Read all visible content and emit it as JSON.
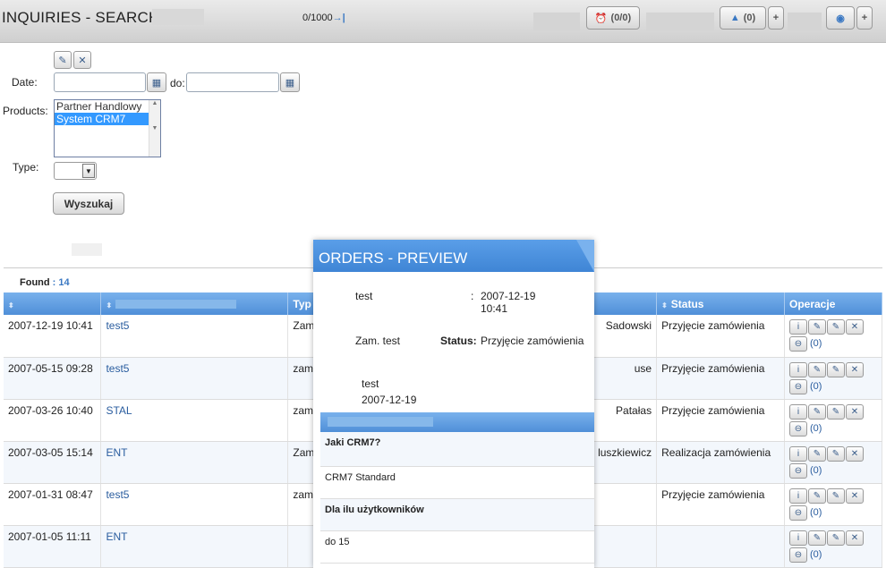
{
  "topbar": {
    "title": "INQUIRIES - SEARCH",
    "counter": "0/1000",
    "counter_arrow": "→|",
    "alarm_btn": "(0/0)",
    "bell_btn": "(0)",
    "plus": "+",
    "alarm_icon": "⏰",
    "bell_icon": "▲",
    "globe_icon": "◉"
  },
  "form": {
    "edit_icon": "✎",
    "close_icon": "✕",
    "date_label": "Date:",
    "do_label": "do:",
    "calendar_icon": "▦",
    "products_label": "Products:",
    "products": [
      {
        "label": "Partner Handlowy",
        "selected": false
      },
      {
        "label": "System CRM7",
        "selected": true
      }
    ],
    "type_label": "Type:",
    "dropdown_icon": "▼",
    "search_button": "Wyszukaj"
  },
  "results": {
    "found_label": "Found",
    "found_sep": ":",
    "found_count": "14",
    "columns": [
      "",
      "",
      "Typ",
      "",
      "Status",
      "Operacje"
    ],
    "sort_icon": "⬍",
    "op_icons": [
      "i",
      "✎",
      "✎",
      "✕"
    ],
    "link_icon": "⊖",
    "rows": [
      {
        "date": "2007-12-19 10:41",
        "name": "test5",
        "typ": "Zam.",
        "person": "Sadowski",
        "status": "Przyjęcie zamówienia",
        "count": "(0)"
      },
      {
        "date": "2007-05-15 09:28",
        "name": "test5",
        "typ": "zamo",
        "person": "use",
        "status": "Przyjęcie zamówienia",
        "count": "(0)"
      },
      {
        "date": "2007-03-26 10:40",
        "name": "STAL",
        "typ": "zamo",
        "person": "Patałas",
        "status": "Przyjęcie zamówienia",
        "count": "(0)"
      },
      {
        "date": "2007-03-05 15:14",
        "name": "ENT",
        "typ": "Zam.",
        "person": "luszkiewicz",
        "status": "Realizacja zamówienia",
        "count": "(0)"
      },
      {
        "date": "2007-01-31 08:47",
        "name": "test5",
        "typ": "zamo",
        "person": "",
        "status": "Przyjęcie zamówienia",
        "count": "(0)"
      },
      {
        "date": "2007-01-05 11:11",
        "name": "ENT",
        "typ": "",
        "person": "",
        "status": "",
        "count": "(0)"
      }
    ]
  },
  "preview": {
    "title": "ORDERS - PREVIEW",
    "name": "test",
    "colon": ":",
    "date": "2007-12-19",
    "time": "10:41",
    "type": "Zam. test",
    "status_label": "Status:",
    "status": "Przyjęcie zamówienia",
    "sub_name": "test",
    "sub_date": "2007-12-19",
    "q1": "Jaki CRM7?",
    "a1": "CRM7 Standard",
    "q2": "Dla ilu użytkowników",
    "a2": "do 15"
  }
}
